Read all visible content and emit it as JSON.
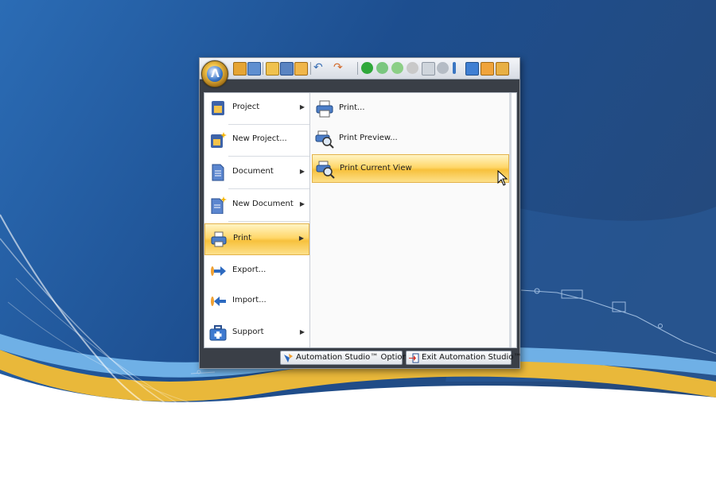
{
  "app_menu": {
    "left_items": [
      {
        "label": "Project",
        "icon": "project-icon",
        "has_submenu": true
      },
      {
        "label": "New Project...",
        "icon": "new-project-icon",
        "has_submenu": false
      },
      {
        "label": "Document",
        "icon": "document-icon",
        "has_submenu": true
      },
      {
        "label": "New Document",
        "icon": "new-document-icon",
        "has_submenu": true
      },
      {
        "label": "Print",
        "icon": "printer-icon",
        "has_submenu": true,
        "selected": true
      },
      {
        "label": "Export...",
        "icon": "export-arrow-icon",
        "has_submenu": false
      },
      {
        "label": "Import...",
        "icon": "import-arrow-icon",
        "has_submenu": false
      },
      {
        "label": "Support",
        "icon": "support-kit-icon",
        "has_submenu": true
      }
    ],
    "submenu_items": [
      {
        "label": "Print...",
        "icon": "print-icon"
      },
      {
        "label": "Print Preview...",
        "icon": "print-preview-icon"
      },
      {
        "label": "Print Current View",
        "icon": "print-current-view-icon",
        "hovered": true
      }
    ],
    "footer": {
      "options_label": "Automation Studio™ Options",
      "exit_label": "Exit Automation Studio™"
    }
  },
  "colors": {
    "background_blue": "#1f4f8c",
    "highlight_gold": "#f7c13c",
    "wave_yellow": "#e9b83a"
  }
}
